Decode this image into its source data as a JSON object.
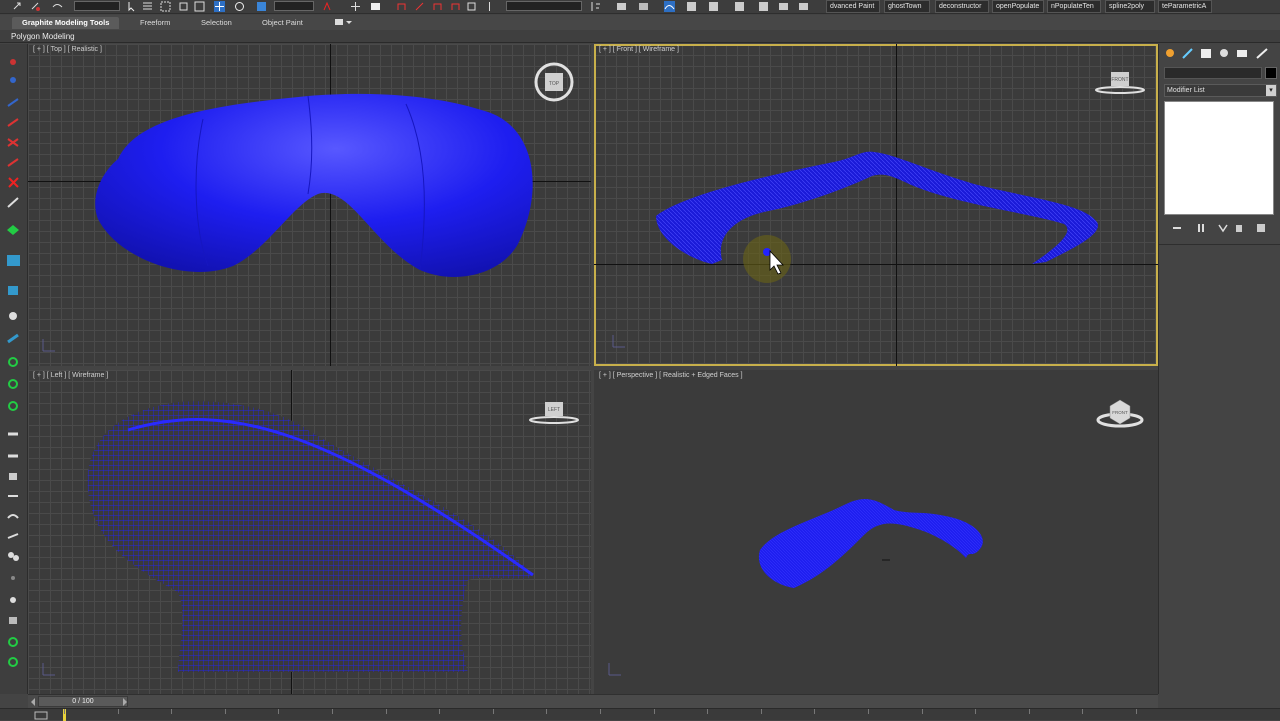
{
  "app": "3ds Max",
  "toolbar": {
    "plugin_buttons": [
      "dvanced Paint",
      "ghostTown",
      "deconstructor",
      "openPopulate",
      "nPopulateTen",
      "spline2poly",
      "teParametricA"
    ]
  },
  "ribbon": {
    "tabs": [
      {
        "label": "Graphite Modeling Tools",
        "active": true
      },
      {
        "label": "Freeform",
        "active": false
      },
      {
        "label": "Selection",
        "active": false
      },
      {
        "label": "Object Paint",
        "active": false
      }
    ],
    "panel_label": "Polygon Modeling"
  },
  "viewports": {
    "top": {
      "label": "[ + ] [ Top ] [ Realistic ]",
      "cube": "TOP"
    },
    "front": {
      "label": "[ + ] [ Front ] [ Wireframe ]",
      "cube": "FRONT",
      "active": true
    },
    "left": {
      "label": "[ + ] [ Left ] [ Wireframe ]",
      "cube": "LEFT"
    },
    "perspective": {
      "label": "[ + ] [ Perspective ] [ Realistic + Edged Faces ]",
      "cube": "FRONT"
    }
  },
  "command_panel": {
    "modifier_list": "Modifier List"
  },
  "timeline": {
    "frame_display": "0 / 100"
  },
  "colors": {
    "object": "#1c1cf0",
    "active_border": "#c8b04b",
    "viewport_bg": "#3b3b3b"
  }
}
